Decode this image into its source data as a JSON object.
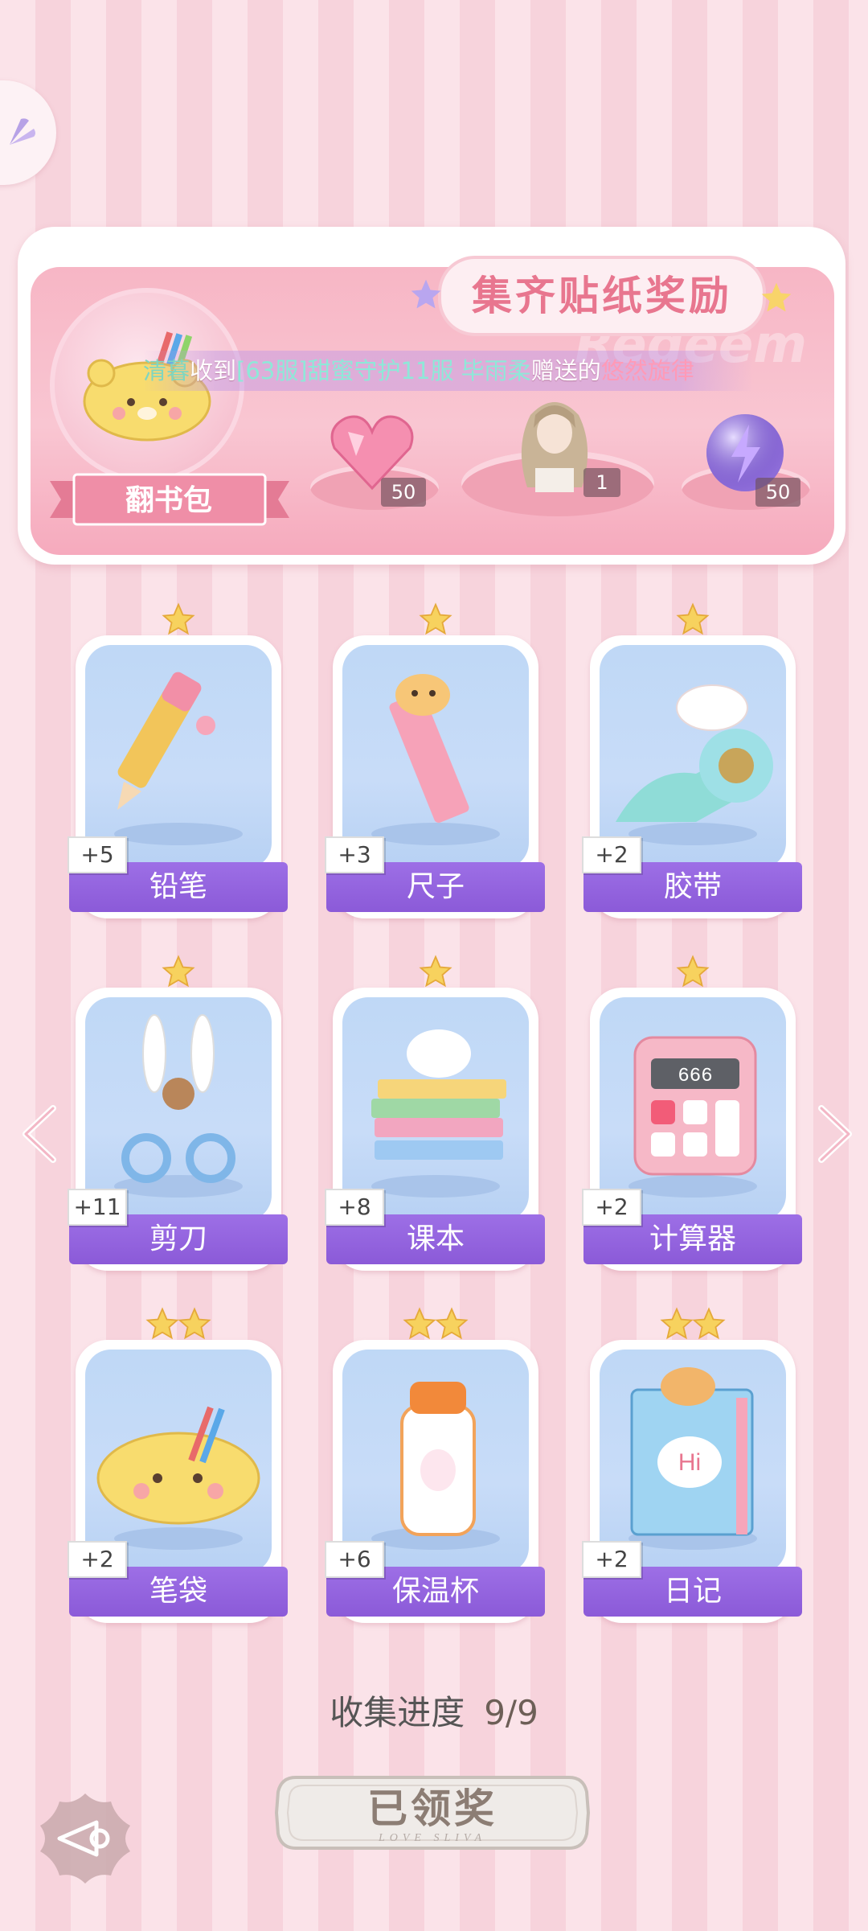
{
  "banner": {
    "title": "集齐贴纸奖励",
    "watermark": "Redeem",
    "ticker": {
      "sender": "清暮",
      "mid1": "收到",
      "item": "[63服]甜蜜守护11服 毕雨柔",
      "mid2": "赠送的",
      "gift": "悠然旋律"
    },
    "featured": {
      "label": "翻书包",
      "icon": "pencil-bag-icon"
    },
    "rewards": [
      {
        "icon": "pink-heart-gem-icon",
        "count": "50"
      },
      {
        "icon": "outfit-portrait-icon",
        "count": "1"
      },
      {
        "icon": "energy-orb-icon",
        "count": "50"
      }
    ]
  },
  "cards": [
    {
      "name": "铅笔",
      "count": "+5",
      "stars": 1,
      "icon": "pencil-icon"
    },
    {
      "name": "尺子",
      "count": "+3",
      "stars": 1,
      "icon": "ruler-icon"
    },
    {
      "name": "胶带",
      "count": "+2",
      "stars": 1,
      "icon": "tape-icon"
    },
    {
      "name": "剪刀",
      "count": "+11",
      "stars": 1,
      "icon": "scissors-icon"
    },
    {
      "name": "课本",
      "count": "+8",
      "stars": 1,
      "icon": "textbooks-icon"
    },
    {
      "name": "计算器",
      "count": "+2",
      "stars": 1,
      "icon": "calculator-icon",
      "display": "666"
    },
    {
      "name": "笔袋",
      "count": "+2",
      "stars": 2,
      "icon": "pencil-case-icon"
    },
    {
      "name": "保温杯",
      "count": "+6",
      "stars": 2,
      "icon": "thermos-icon"
    },
    {
      "name": "日记",
      "count": "+2",
      "stars": 2,
      "icon": "diary-icon",
      "display": "Hi"
    }
  ],
  "progress": {
    "label": "收集进度",
    "value": "9/9"
  },
  "claim_button": {
    "label": "已领奖",
    "sub": "LOVE SLIVA"
  },
  "colors": {
    "ribbon": "#8b5ad8",
    "accent_pink": "#e8768f",
    "card_bg": "#c8dcf8"
  }
}
